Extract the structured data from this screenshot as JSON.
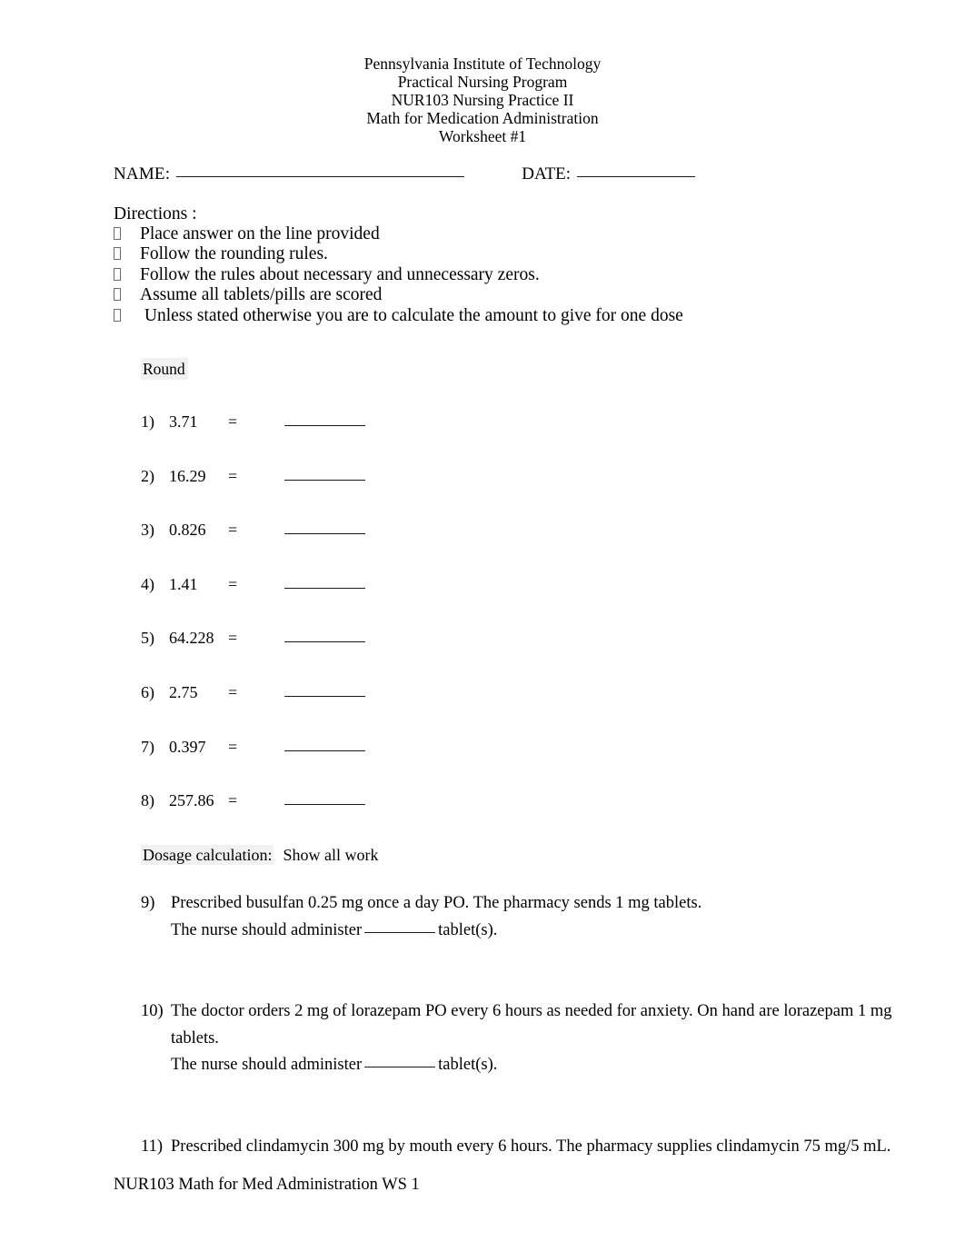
{
  "document": {
    "header_lines": [
      "Pennsylvania Institute of Technology",
      "Practical Nursing Program",
      "NUR103 Nursing Practice II",
      "Math for Medication Administration",
      "Worksheet #1"
    ],
    "footer": "NUR103 Math for Med Administration WS 1"
  },
  "fields": {
    "name_label": "NAME:",
    "date_label": "DATE:"
  },
  "directions": {
    "title": "Directions :",
    "bullet_glyph": "missing-glyph-box",
    "items": [
      "Place answer on the line provided",
      "Follow the rounding rules.",
      "Follow the rules about necessary and unnecessary zeros.",
      "Assume all tablets/pills are scored",
      " Unless stated otherwise you are to calculate the amount to give for one dose"
    ]
  },
  "round_section": {
    "heading": "Round",
    "highlight_color": "#f1f1f1",
    "equals_symbol": "=",
    "items": [
      {
        "number": "1)",
        "value": "3.71"
      },
      {
        "number": "2)",
        "value": "16.29"
      },
      {
        "number": "3)",
        "value": "0.826"
      },
      {
        "number": "4)",
        "value": "1.41"
      },
      {
        "number": "5)",
        "value": "64.228"
      },
      {
        "number": "6)",
        "value": "2.75"
      },
      {
        "number": "7)",
        "value": "0.397"
      },
      {
        "number": "8)",
        "value": "257.86"
      }
    ]
  },
  "dosage_section": {
    "heading_highlighted": "Dosage calculation:",
    "heading_plain": "Show all work",
    "problems": [
      {
        "number": "9)",
        "line1": "Prescribed busulfan 0.25 mg once a day PO. The pharmacy sends 1 mg tablets.",
        "answer_prefix": "The nurse should administer",
        "answer_suffix": "tablet(s)."
      },
      {
        "number": "10)",
        "line1": "The doctor orders 2 mg of lorazepam PO every 6 hours as needed for anxiety. On hand are lorazepam 1 mg",
        "line2": "tablets.",
        "answer_prefix": "The nurse should administer",
        "answer_suffix": "tablet(s)."
      },
      {
        "number": "11)",
        "line1": "Prescribed clindamycin 300 mg by mouth every 6 hours. The pharmacy supplies clindamycin 75 mg/5 mL."
      }
    ]
  }
}
